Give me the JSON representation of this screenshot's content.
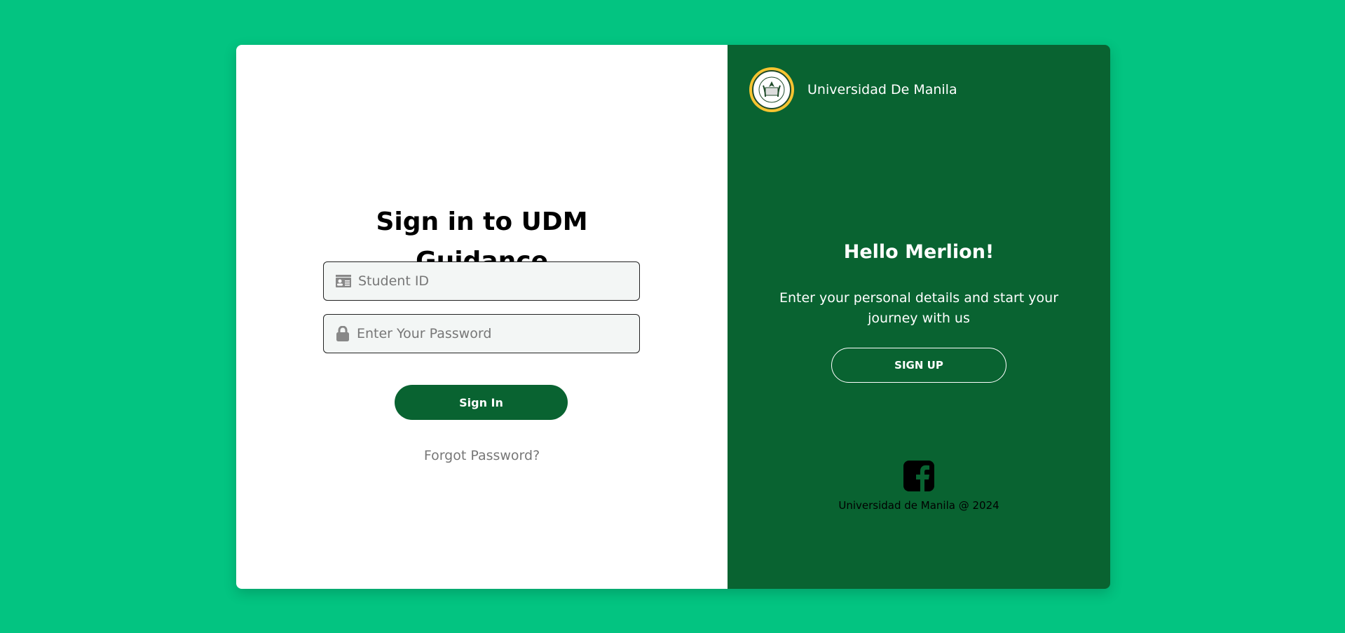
{
  "colors": {
    "background": "#03c481",
    "brand_green": "#096331",
    "input_bg": "#f3f6f5"
  },
  "login": {
    "title_line1": "Sign in to UDM",
    "title_line2": "Guidance",
    "student_id_placeholder": "Student ID",
    "student_id_icon": "id-card-icon",
    "password_placeholder": "Enter Your Password",
    "password_icon": "lock-icon",
    "signin_label": "Sign In",
    "forgot_label": "Forgot Password?"
  },
  "panel": {
    "brand_name": "Universidad De Manila",
    "logo_text": "UNIVERSIDAD DE MANILA",
    "greeting": "Hello Merlion!",
    "description": "Enter your personal details and start your journey with us",
    "signup_label": "SIGN UP",
    "social_icon": "facebook-icon",
    "footer": "Universidad de Manila @ 2024"
  }
}
